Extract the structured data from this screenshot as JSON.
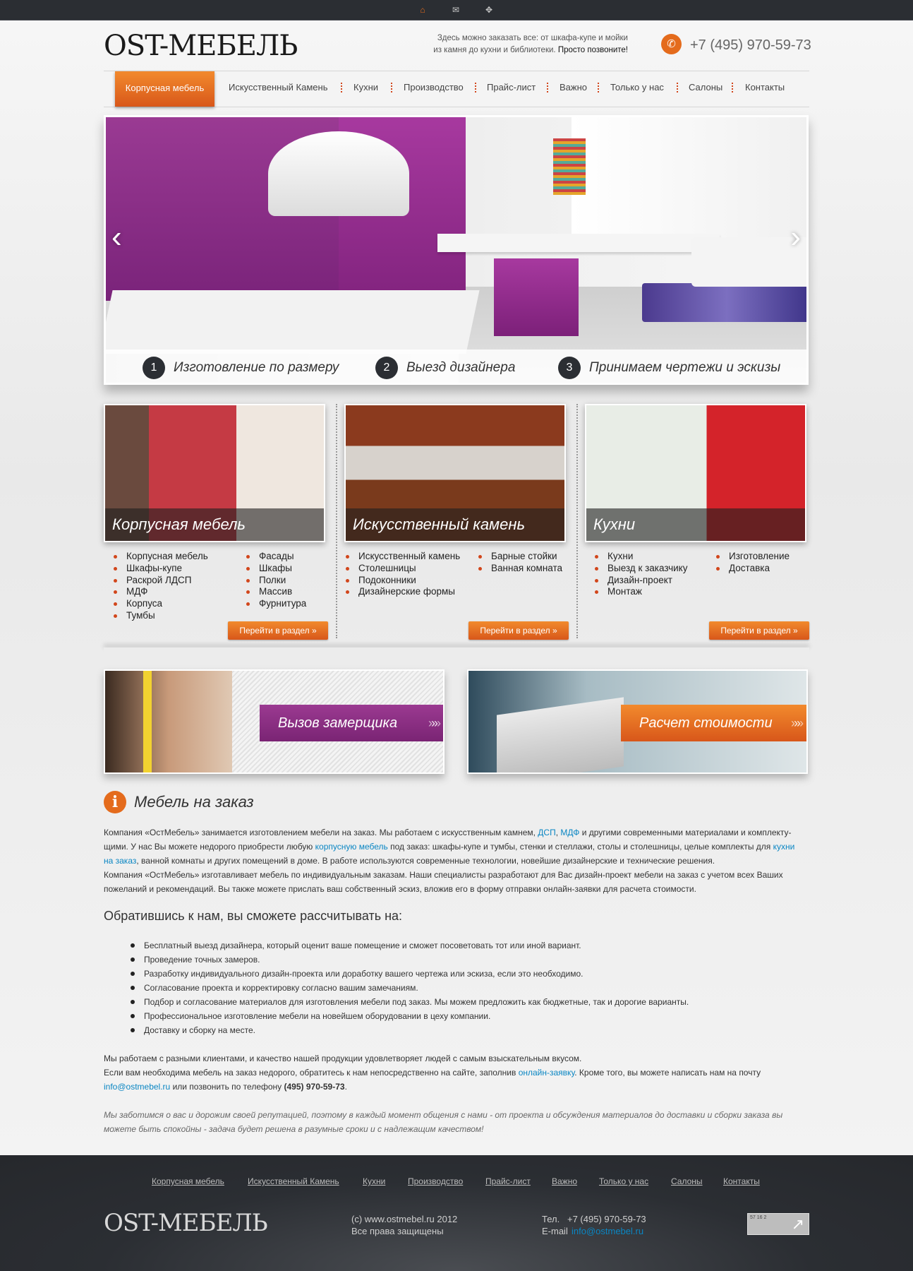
{
  "topbar": {
    "home_icon": "home-icon",
    "mail_icon": "mail-icon",
    "sitemap_icon": "sitemap-icon"
  },
  "header": {
    "logo": "OST-МЕБЕЛЬ",
    "tagline_line1": "Здесь можно заказать все: от шкафа-купе и мойки",
    "tagline_line2": "из камня до кухни и библиотеки.",
    "tagline_call": "Просто позвоните!",
    "phone": "+7 (495) 970-59-73"
  },
  "nav": {
    "items": [
      "Корпусная мебель",
      "Искусственный Камень",
      "Кухни",
      "Производство",
      "Прайс-лист",
      "Важно",
      "Только у нас",
      "Салоны",
      "Контакты"
    ]
  },
  "slider": {
    "captions": [
      {
        "num": "1",
        "text": "Изготовление по размеру"
      },
      {
        "num": "2",
        "text": "Выезд дизайнера"
      },
      {
        "num": "3",
        "text": "Принимаем чертежи и эскизы"
      }
    ]
  },
  "sections": [
    {
      "title": "Корпусная мебель",
      "col1": [
        "Корпусная мебель",
        "Шкафы-купе",
        "Раскрой ЛДСП",
        "МДФ",
        "Корпуса",
        "Тумбы"
      ],
      "col2": [
        "Фасады",
        "Шкафы",
        "Полки",
        "Массив",
        "Фурнитура"
      ],
      "button": "Перейти в раздел"
    },
    {
      "title": "Искусственный камень",
      "col1": [
        "Искусственный камень",
        "Столешницы",
        "Подоконники",
        "Дизайнерские формы"
      ],
      "col2": [
        "Барные стойки",
        "Ванная комната"
      ],
      "button": "Перейти в раздел"
    },
    {
      "title": "Кухни",
      "col1": [
        "Кухни",
        "Выезд к заказчику",
        "Дизайн-проект",
        "Монтаж"
      ],
      "col2": [
        "Изготовление",
        "Доставка"
      ],
      "button": "Перейти в раздел"
    }
  ],
  "banners": {
    "measurer": "Вызов замерщика",
    "cost": "Расчет стоимости"
  },
  "content": {
    "title": "Мебель на заказ",
    "p1_a": "Компания «ОстМебель» занимается изготовлением мебели на заказ. Мы работаем с искусственным камнем, ",
    "p1_link1": "ДСП",
    "p1_comma": ", ",
    "p1_link2": "МДФ",
    "p1_b": " и другими современными материалами и комплекту-",
    "p2_a": "щими. У нас Вы можете недорого приобрести любую ",
    "p2_link": "корпусную мебель",
    "p2_b": " под заказ: шкафы-купе и тумбы, стенки и стеллажи, столы и столешницы, целые комплекты для ",
    "p2_link2a": "кухни",
    "p3_link2b": "на заказ",
    "p3_b": ", ванной комнаты и других помещений в доме. В работе используются современные технологии, новейшие дизайнерские и технические решения.",
    "p4": "Компания «ОстМебель» изготавливает мебель по индивидуальным заказам. Наши специалисты разработают для Вас дизайн-проект мебели на заказ с учетом всех Ваших",
    "p5": "пожеланий и рекомендаций. Вы также можете прислать ваш собственный эскиз, вложив его в форму отправки онлайн-заявки для расчета стоимости.",
    "subtitle": "Обратившись к нам, вы сможете рассчитывать на:",
    "bullets": [
      "Бесплатный выезд дизайнера, который оценит ваше помещение и сможет посоветовать тот или иной вариант.",
      "Проведение точных замеров.",
      "Разработку индивидуального дизайн-проекта или доработку вашего чертежа или эскиза, если это необходимо.",
      "Согласование проекта и корректировку согласно вашим замечаниям.",
      "Подбор и согласование материалов для изготовления мебели под заказ. Мы можем предложить как бюджетные, так и дорогие варианты.",
      "Профессиональное изготовление мебели на новейшем оборудовании в цеху компании.",
      "Доставку и сборку на месте."
    ],
    "q1": "Мы работаем с разными клиентами, и качество нашей продукции удовлетворяет людей с самым взыскательным вкусом.",
    "q2_a": "Если вам необходима мебель на заказ недорого, обратитесь к нам непосредственно на сайте, заполнив ",
    "q2_link": "онлайн-заявку",
    "q2_b": ". Кроме того, вы можете написать нам на почту",
    "q3_link": "info@ostmebel.ru",
    "q3_a": " или позвонить по телефону ",
    "q3_phone": "(495) 970-59-73",
    "q3_b": ".",
    "italic1": "Мы заботимся о вас и дорожим своей репутацией, поэтому в каждый момент общения с нами - от проекта и обсуждения материалов до доставки и сборки заказа вы",
    "italic2": "можете быть спокойны - задача будет решена в разумные сроки и с надлежащим качеством!"
  },
  "footer": {
    "nav": [
      "Корпусная мебель",
      "Искусственный Камень",
      "Кухни",
      "Производство",
      "Прайс-лист",
      "Важно",
      "Только у нас",
      "Салоны",
      "Контакты"
    ],
    "logo": "OST-МЕБЕЛЬ",
    "copyright": "(c) www.ostmebel.ru 2012",
    "rights": "Все права защищены",
    "tel_label": "Тел.",
    "tel": "+7 (495) 970-59-73",
    "email_label": "E-mail",
    "email": "info@ostmebel.ru",
    "counter_digits": "57 16 2"
  },
  "colors": {
    "accent": "#e46b1c",
    "purple": "#8a2a85",
    "link": "#0a86c3",
    "dark": "#2b2e33"
  }
}
